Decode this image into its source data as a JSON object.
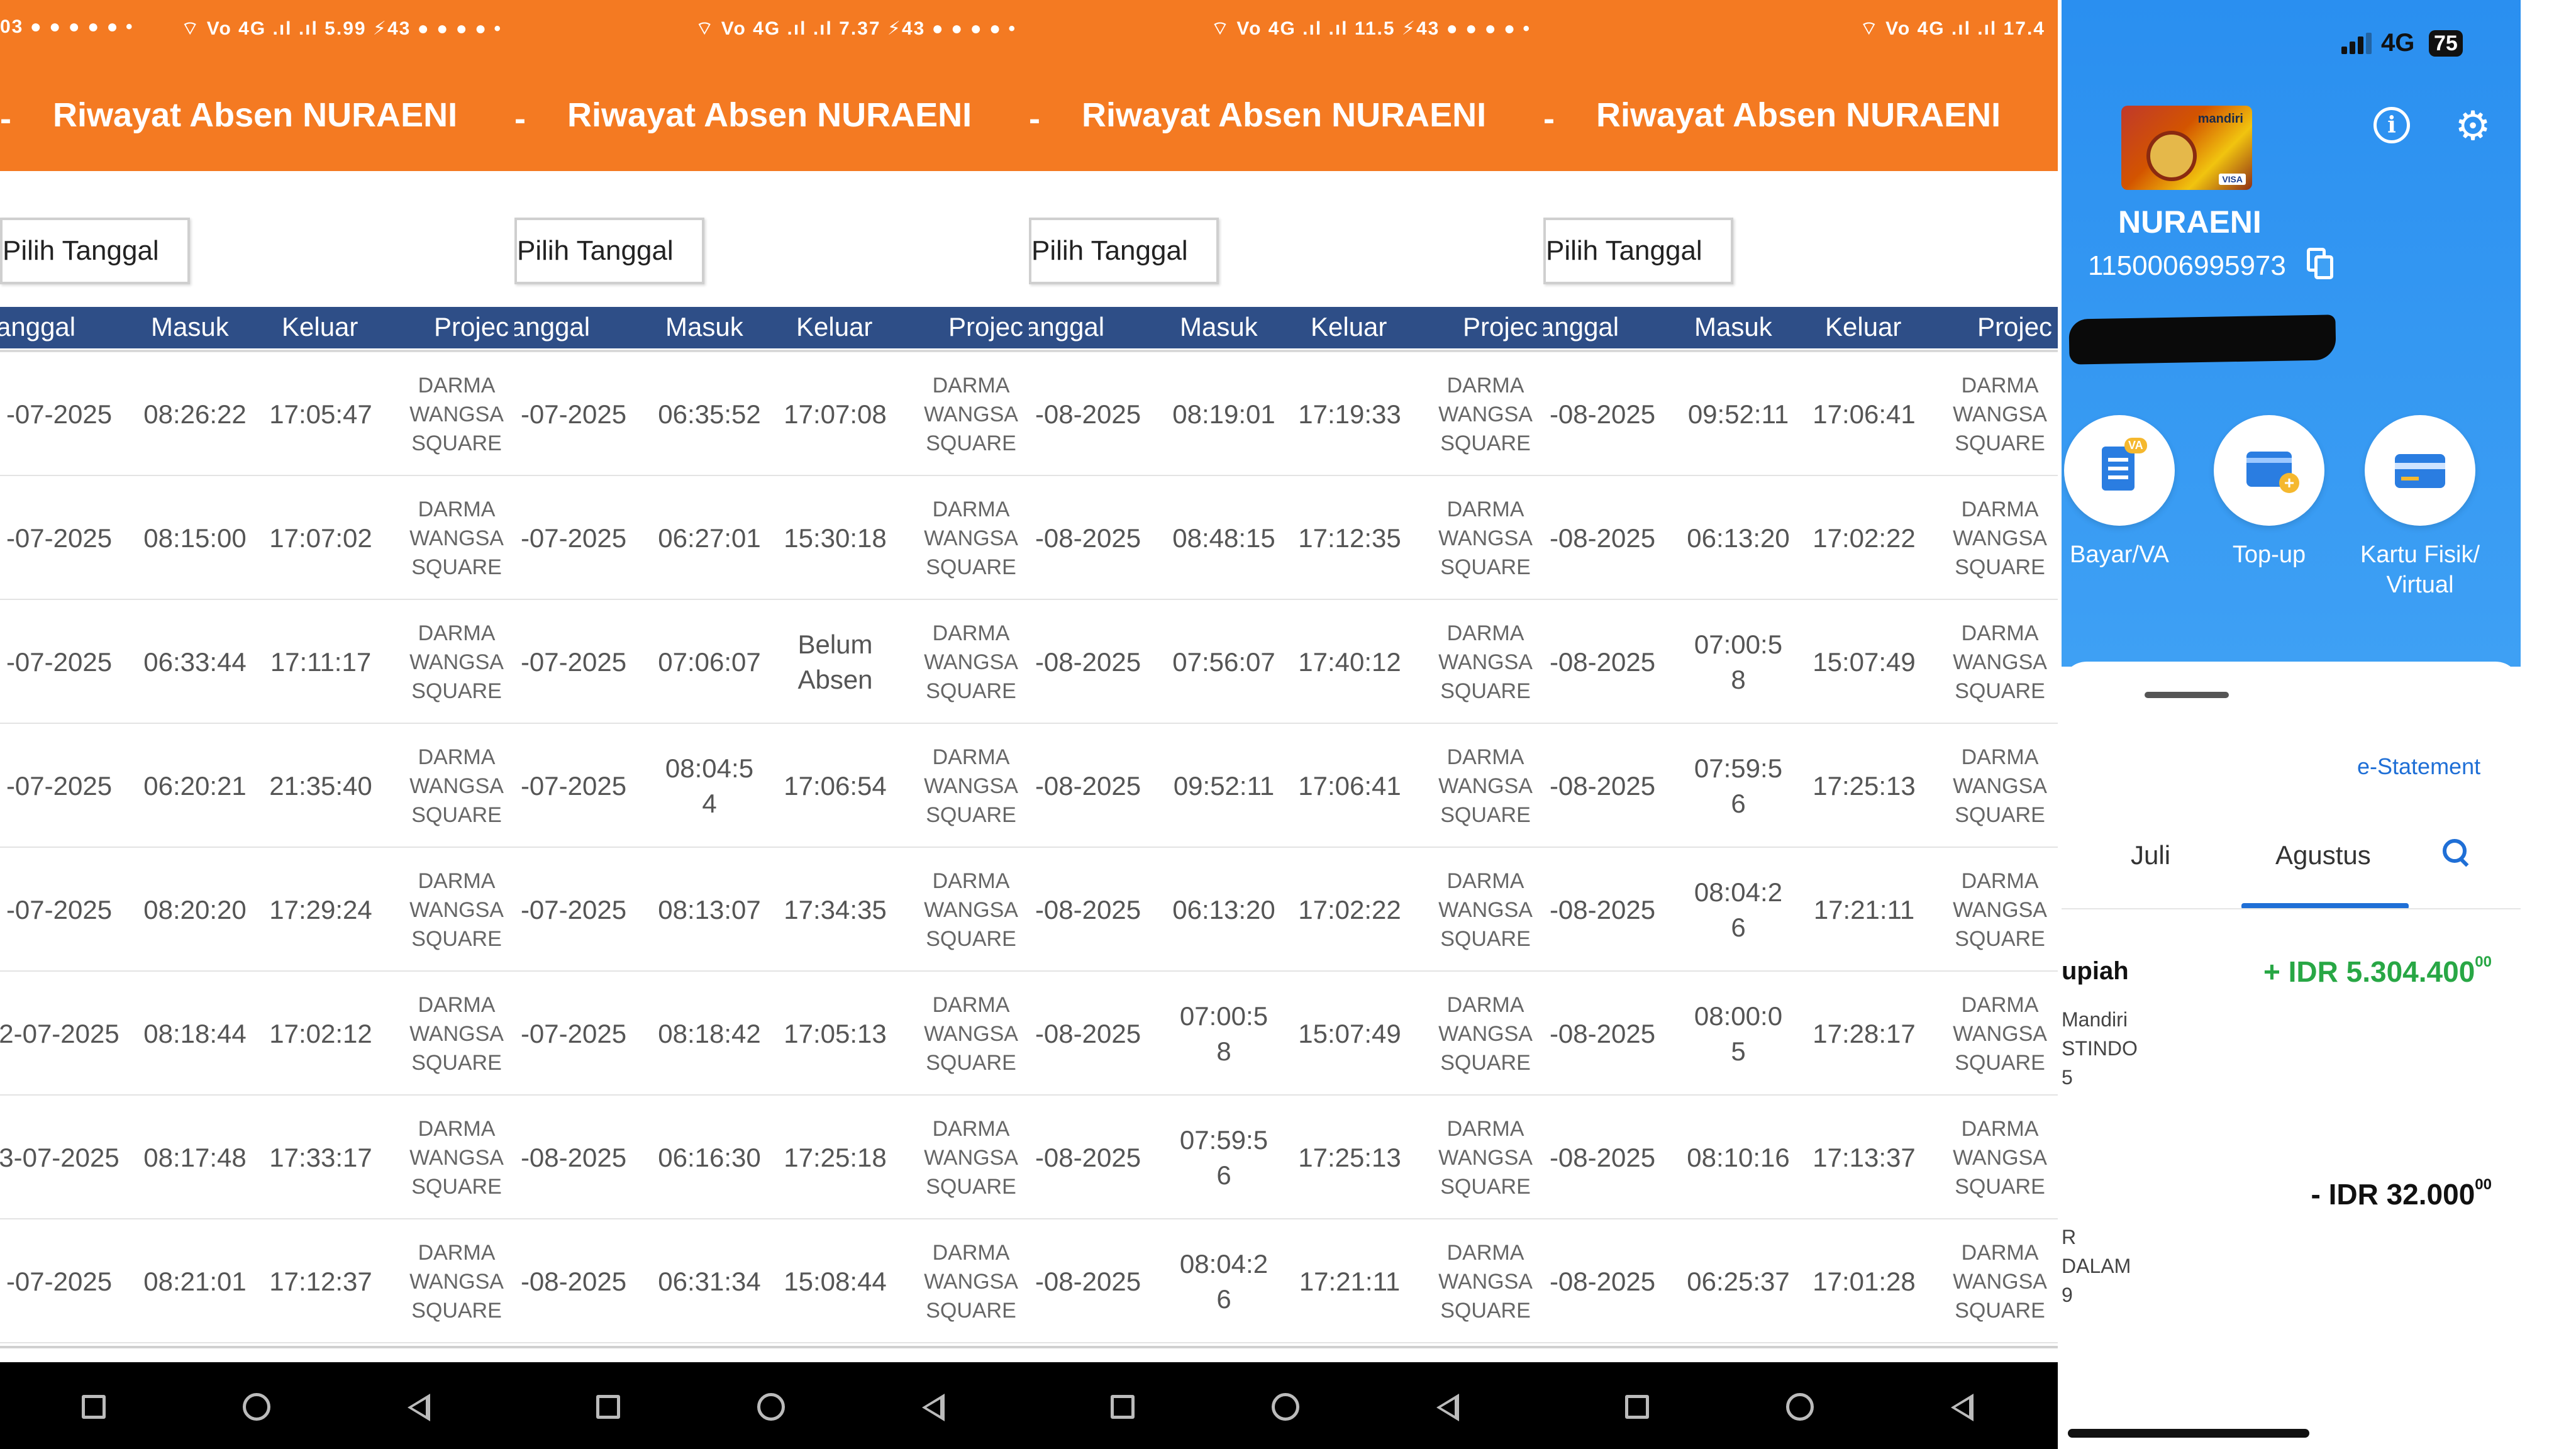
{
  "strips": [
    {
      "status_left": "03 ● ● ● ● ● •",
      "status_right": "⌔ Vo 4G .ıl .ıl 5.99 ⚡43 ● ● ● ● •",
      "dash": "-",
      "title": "Riwayat Absen NURAENI",
      "pick_label": "Pilih Tanggal",
      "headers": [
        "anggal",
        "Masuk",
        "Keluar",
        "Projec"
      ],
      "rows": [
        {
          "date": "-07-2025",
          "in": "08:26:22",
          "out": "17:05:47",
          "proj": "DARMA\nWANGSA\nSQUARE"
        },
        {
          "date": "-07-2025",
          "in": "08:15:00",
          "out": "17:07:02",
          "proj": "DARMA\nWANGSA\nSQUARE"
        },
        {
          "date": "-07-2025",
          "in": "06:33:44",
          "out": "17:11:17",
          "proj": "DARMA\nWANGSA\nSQUARE"
        },
        {
          "date": "-07-2025",
          "in": "06:20:21",
          "out": "21:35:40",
          "proj": "DARMA\nWANGSA\nSQUARE"
        },
        {
          "date": "-07-2025",
          "in": "08:20:20",
          "out": "17:29:24",
          "proj": "DARMA\nWANGSA\nSQUARE"
        },
        {
          "date": "2-07-2025",
          "in": "08:18:44",
          "out": "17:02:12",
          "proj": "DARMA\nWANGSA\nSQUARE"
        },
        {
          "date": "3-07-2025",
          "in": "08:17:48",
          "out": "17:33:17",
          "proj": "DARMA\nWANGSA\nSQUARE"
        },
        {
          "date": "-07-2025",
          "in": "08:21:01",
          "out": "17:12:37",
          "proj": "DARMA\nWANGSA\nSQUARE"
        }
      ]
    },
    {
      "status_left": "",
      "status_right": "⌔ Vo 4G .ıl .ıl 7.37 ⚡43 ● ● ● ● •",
      "dash": "-",
      "title": "Riwayat Absen NURAENI",
      "pick_label": "Pilih Tanggal",
      "headers": [
        "anggal",
        "Masuk",
        "Keluar",
        "Projec"
      ],
      "rows": [
        {
          "date": "-07-2025",
          "in": "06:35:52",
          "out": "17:07:08",
          "proj": "DARMA\nWANGSA\nSQUARE"
        },
        {
          "date": "-07-2025",
          "in": "06:27:01",
          "out": "15:30:18",
          "proj": "DARMA\nWANGSA\nSQUARE"
        },
        {
          "date": "-07-2025",
          "in": "07:06:07",
          "out": "Belum\nAbsen",
          "proj": "DARMA\nWANGSA\nSQUARE"
        },
        {
          "date": "-07-2025",
          "in": "08:04:5\n4",
          "out": "17:06:54",
          "proj": "DARMA\nWANGSA\nSQUARE"
        },
        {
          "date": "-07-2025",
          "in": "08:13:07",
          "out": "17:34:35",
          "proj": "DARMA\nWANGSA\nSQUARE"
        },
        {
          "date": "-07-2025",
          "in": "08:18:42",
          "out": "17:05:13",
          "proj": "DARMA\nWANGSA\nSQUARE"
        },
        {
          "date": "-08-2025",
          "in": "06:16:30",
          "out": "17:25:18",
          "proj": "DARMA\nWANGSA\nSQUARE"
        },
        {
          "date": "-08-2025",
          "in": "06:31:34",
          "out": "15:08:44",
          "proj": "DARMA\nWANGSA\nSQUARE"
        }
      ]
    },
    {
      "status_left": "",
      "status_right": "⌔ Vo 4G .ıl .ıl 11.5 ⚡43 ● ● ● ● •",
      "dash": "-",
      "title": "Riwayat Absen NURAENI",
      "pick_label": "Pilih Tanggal",
      "headers": [
        "anggal",
        "Masuk",
        "Keluar",
        "Projec"
      ],
      "rows": [
        {
          "date": "-08-2025",
          "in": "08:19:01",
          "out": "17:19:33",
          "proj": "DARMA\nWANGSA\nSQUARE"
        },
        {
          "date": "-08-2025",
          "in": "08:48:15",
          "out": "17:12:35",
          "proj": "DARMA\nWANGSA\nSQUARE"
        },
        {
          "date": "-08-2025",
          "in": "07:56:07",
          "out": "17:40:12",
          "proj": "DARMA\nWANGSA\nSQUARE"
        },
        {
          "date": "-08-2025",
          "in": "09:52:11",
          "out": "17:06:41",
          "proj": "DARMA\nWANGSA\nSQUARE"
        },
        {
          "date": "-08-2025",
          "in": "06:13:20",
          "out": "17:02:22",
          "proj": "DARMA\nWANGSA\nSQUARE"
        },
        {
          "date": "-08-2025",
          "in": "07:00:5\n8",
          "out": "15:07:49",
          "proj": "DARMA\nWANGSA\nSQUARE"
        },
        {
          "date": "-08-2025",
          "in": "07:59:5\n6",
          "out": "17:25:13",
          "proj": "DARMA\nWANGSA\nSQUARE"
        },
        {
          "date": "-08-2025",
          "in": "08:04:2\n6",
          "out": "17:21:11",
          "proj": "DARMA\nWANGSA\nSQUARE"
        }
      ]
    },
    {
      "status_left": "",
      "status_right": "⌔ Vo 4G .ıl .ıl 17.4",
      "dash": "-",
      "title": "Riwayat Absen NURAENI",
      "pick_label": "Pilih Tanggal",
      "headers": [
        "anggal",
        "Masuk",
        "Keluar",
        "Projec"
      ],
      "rows": [
        {
          "date": "-08-2025",
          "in": "09:52:11",
          "out": "17:06:41",
          "proj": "DARMA\nWANGSA\nSQUARE"
        },
        {
          "date": "-08-2025",
          "in": "06:13:20",
          "out": "17:02:22",
          "proj": "DARMA\nWANGSA\nSQUARE"
        },
        {
          "date": "-08-2025",
          "in": "07:00:5\n8",
          "out": "15:07:49",
          "proj": "DARMA\nWANGSA\nSQUARE"
        },
        {
          "date": "-08-2025",
          "in": "07:59:5\n6",
          "out": "17:25:13",
          "proj": "DARMA\nWANGSA\nSQUARE"
        },
        {
          "date": "-08-2025",
          "in": "08:04:2\n6",
          "out": "17:21:11",
          "proj": "DARMA\nWANGSA\nSQUARE"
        },
        {
          "date": "-08-2025",
          "in": "08:00:0\n5",
          "out": "17:28:17",
          "proj": "DARMA\nWANGSA\nSQUARE"
        },
        {
          "date": "-08-2025",
          "in": "08:10:16",
          "out": "17:13:37",
          "proj": "DARMA\nWANGSA\nSQUARE"
        },
        {
          "date": "-08-2025",
          "in": "06:25:37",
          "out": "17:01:28",
          "proj": "DARMA\nWANGSA\nSQUARE"
        }
      ]
    }
  ],
  "bank": {
    "network": "4G",
    "battery": "75",
    "card_brand": "mandiri",
    "card_network": "VISA",
    "name": "NURAENI",
    "account": "1150006995973",
    "actions": [
      {
        "label": "Bayar/VA",
        "badge": "VA"
      },
      {
        "label": "Top-up",
        "badge": "+"
      },
      {
        "label": "Kartu Fisik/\nVirtual",
        "badge": ""
      }
    ],
    "estatement": "e-Statement",
    "tabs": [
      "Juli",
      "Agustus"
    ],
    "active_tab": "Agustus",
    "transactions": [
      {
        "title": "upiah",
        "sub": "Mandiri\nSTINDO\n5",
        "amount": "+ IDR 5.304.400",
        "cents": "00",
        "color": "#28a745"
      },
      {
        "title": "",
        "sub": "R\nDALAM\n9",
        "amount": "- IDR 32.000",
        "cents": "00",
        "color": "#111111"
      }
    ]
  },
  "colors": {
    "orange": "#f47a22",
    "table_header": "#2e4e87",
    "bank_blue": "#2a8ff0",
    "positive": "#28a745",
    "link": "#1f6fd6"
  }
}
